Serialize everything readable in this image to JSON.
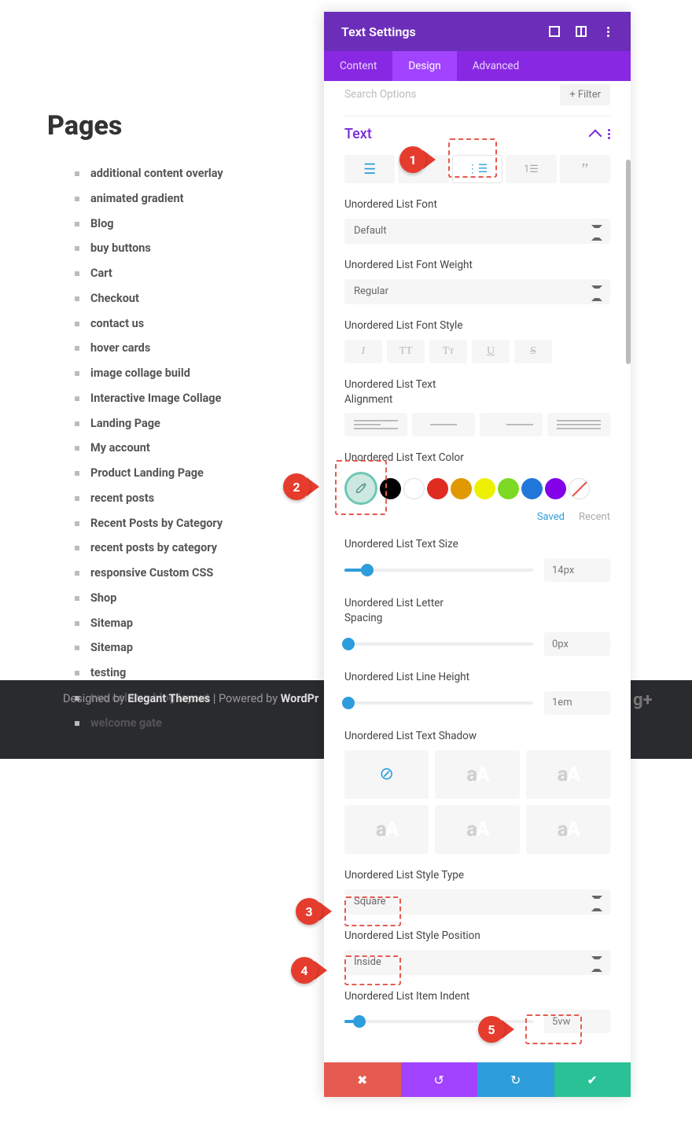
{
  "page": {
    "title": "Pages",
    "list": [
      "additional content overlay",
      "animated gradient",
      "Blog",
      "buy buttons",
      "Cart",
      "Checkout",
      "contact us",
      "hover cards",
      "image collage build",
      "Interactive Image Collage",
      "Landing Page",
      "My account",
      "Product Landing Page",
      "recent posts",
      "Recent Posts by Category",
      "recent posts by category",
      "responsive Custom CSS",
      "Shop",
      "Sitemap",
      "Sitemap",
      "testing",
      "two column blog layout",
      "welcome gate"
    ]
  },
  "footer": {
    "designed_by": "Designed by ",
    "theme": "Elegant Themes",
    "powered_by": " | Powered by ",
    "platform": "WordPr"
  },
  "panel": {
    "title": "Text Settings",
    "tabs": [
      "Content",
      "Design",
      "Advanced"
    ],
    "active_tab": "Design",
    "search_placeholder": "Search Options",
    "filter_label": "+  Filter",
    "section": "Text",
    "icon_tabs": [
      "paragraph",
      "heading",
      "ul",
      "ol",
      "quote"
    ],
    "active_icon_tab": "ul",
    "fields": {
      "font": {
        "label": "Unordered List Font",
        "value": "Default"
      },
      "weight": {
        "label": "Unordered List Font Weight",
        "value": "Regular"
      },
      "style": {
        "label": "Unordered List Font Style",
        "buttons": [
          "I",
          "TT",
          "Tт",
          "U",
          "S"
        ]
      },
      "align": {
        "label": "Unordered List Text Alignment"
      },
      "color": {
        "label": "Unordered List Text Color",
        "swatches": [
          "picker",
          "#000000",
          "#ffffff",
          "#e02b20",
          "#e09900",
          "#edf000",
          "#7cda24",
          "#2176d9",
          "#8300e9",
          "clear"
        ],
        "saved": "Saved",
        "recent": "Recent"
      },
      "size": {
        "label": "Unordered List Text Size",
        "value": "14px",
        "pct": 12
      },
      "spacing": {
        "label": "Unordered List Letter Spacing",
        "value": "0px",
        "pct": 2
      },
      "lineheight": {
        "label": "Unordered List Line Height",
        "value": "1em",
        "pct": 2
      },
      "shadow": {
        "label": "Unordered List Text Shadow"
      },
      "listtype": {
        "label": "Unordered List Style Type",
        "value": "Square"
      },
      "listpos": {
        "label": "Unordered List Style Position",
        "value": "Inside"
      },
      "indent": {
        "label": "Unordered List Item Indent",
        "value": "5vw",
        "pct": 8
      }
    }
  },
  "callouts": {
    "1": "1",
    "2": "2",
    "3": "3",
    "4": "4",
    "5": "5"
  },
  "colors": {
    "purple": "#8928e3",
    "blue": "#2e9ddb"
  }
}
